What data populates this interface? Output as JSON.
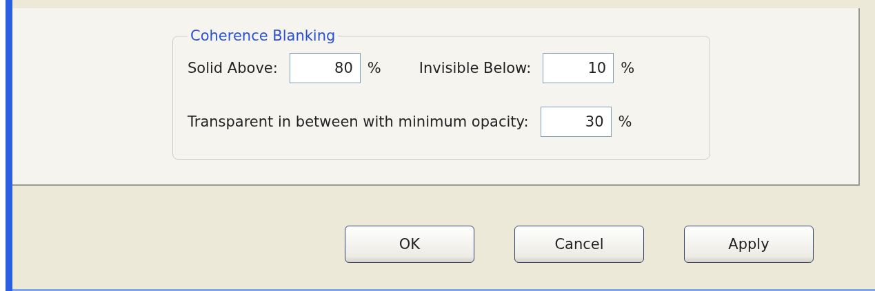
{
  "group": {
    "title": "Coherence Blanking",
    "rows": [
      {
        "fields": [
          {
            "label": "Solid Above:",
            "value": "80",
            "unit": "%"
          },
          {
            "label": "Invisible Below:",
            "value": "10",
            "unit": "%"
          }
        ]
      },
      {
        "fields": [
          {
            "label": "Transparent in between with minimum opacity:",
            "value": "30",
            "unit": "%"
          }
        ]
      }
    ]
  },
  "buttons": [
    "OK",
    "Cancel",
    "Apply"
  ]
}
